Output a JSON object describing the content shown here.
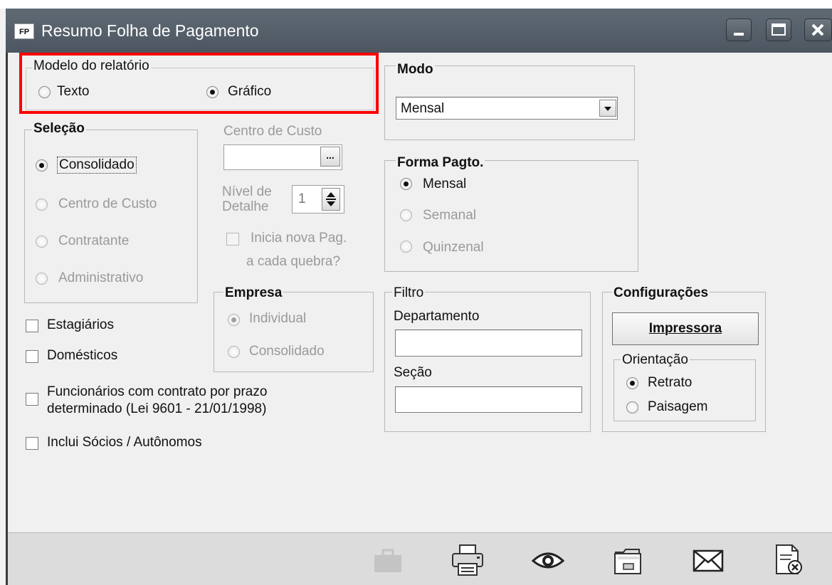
{
  "window": {
    "title": "Resumo Folha de Pagamento",
    "icon_text": "FP"
  },
  "modelo": {
    "legend": "Modelo do relatório",
    "texto": "Texto",
    "grafico": "Gráfico",
    "selected": "Gráfico"
  },
  "modo": {
    "legend": "Modo",
    "value": "Mensal"
  },
  "selecao": {
    "legend": "Seleção",
    "options": [
      "Consolidado",
      "Centro de Custo",
      "Contratante",
      "Administrativo"
    ],
    "selected": "Consolidado"
  },
  "centro_custo": {
    "label": "Centro de Custo",
    "button": "...",
    "nivel_label_1": "Nível de",
    "nivel_label_2": "Detalhe",
    "nivel_value": "1",
    "inicia_1": "Inicia nova Pag.",
    "inicia_2": "a cada quebra?"
  },
  "forma_pagto": {
    "legend": "Forma Pagto.",
    "options": [
      "Mensal",
      "Semanal",
      "Quinzenal"
    ],
    "selected": "Mensal"
  },
  "empresa": {
    "legend": "Empresa",
    "options": [
      "Individual",
      "Consolidado"
    ],
    "selected": "Individual"
  },
  "filtro": {
    "legend": "Filtro",
    "departamento": "Departamento",
    "secao": "Seção"
  },
  "configuracoes": {
    "legend": "Configurações",
    "impressora": "Impressora",
    "orientacao": "Orientação",
    "retrato": "Retrato",
    "paisagem": "Paisagem",
    "selected": "Retrato"
  },
  "checks": {
    "estagiarios": "Estagiários",
    "domesticos": "Domésticos",
    "func_1": "Funcionários com contrato por prazo",
    "func_2": "determinado (Lei 9601 - 21/01/1998)",
    "socios": "Inclui Sócios / Autônomos"
  },
  "toolbar": {
    "icons": [
      "briefcase-icon",
      "printer-icon",
      "eye-icon",
      "folder-icon",
      "envelope-icon",
      "close-document-icon"
    ]
  },
  "colors": {
    "highlight": "#ff0000",
    "titlebar": "#56606a"
  }
}
